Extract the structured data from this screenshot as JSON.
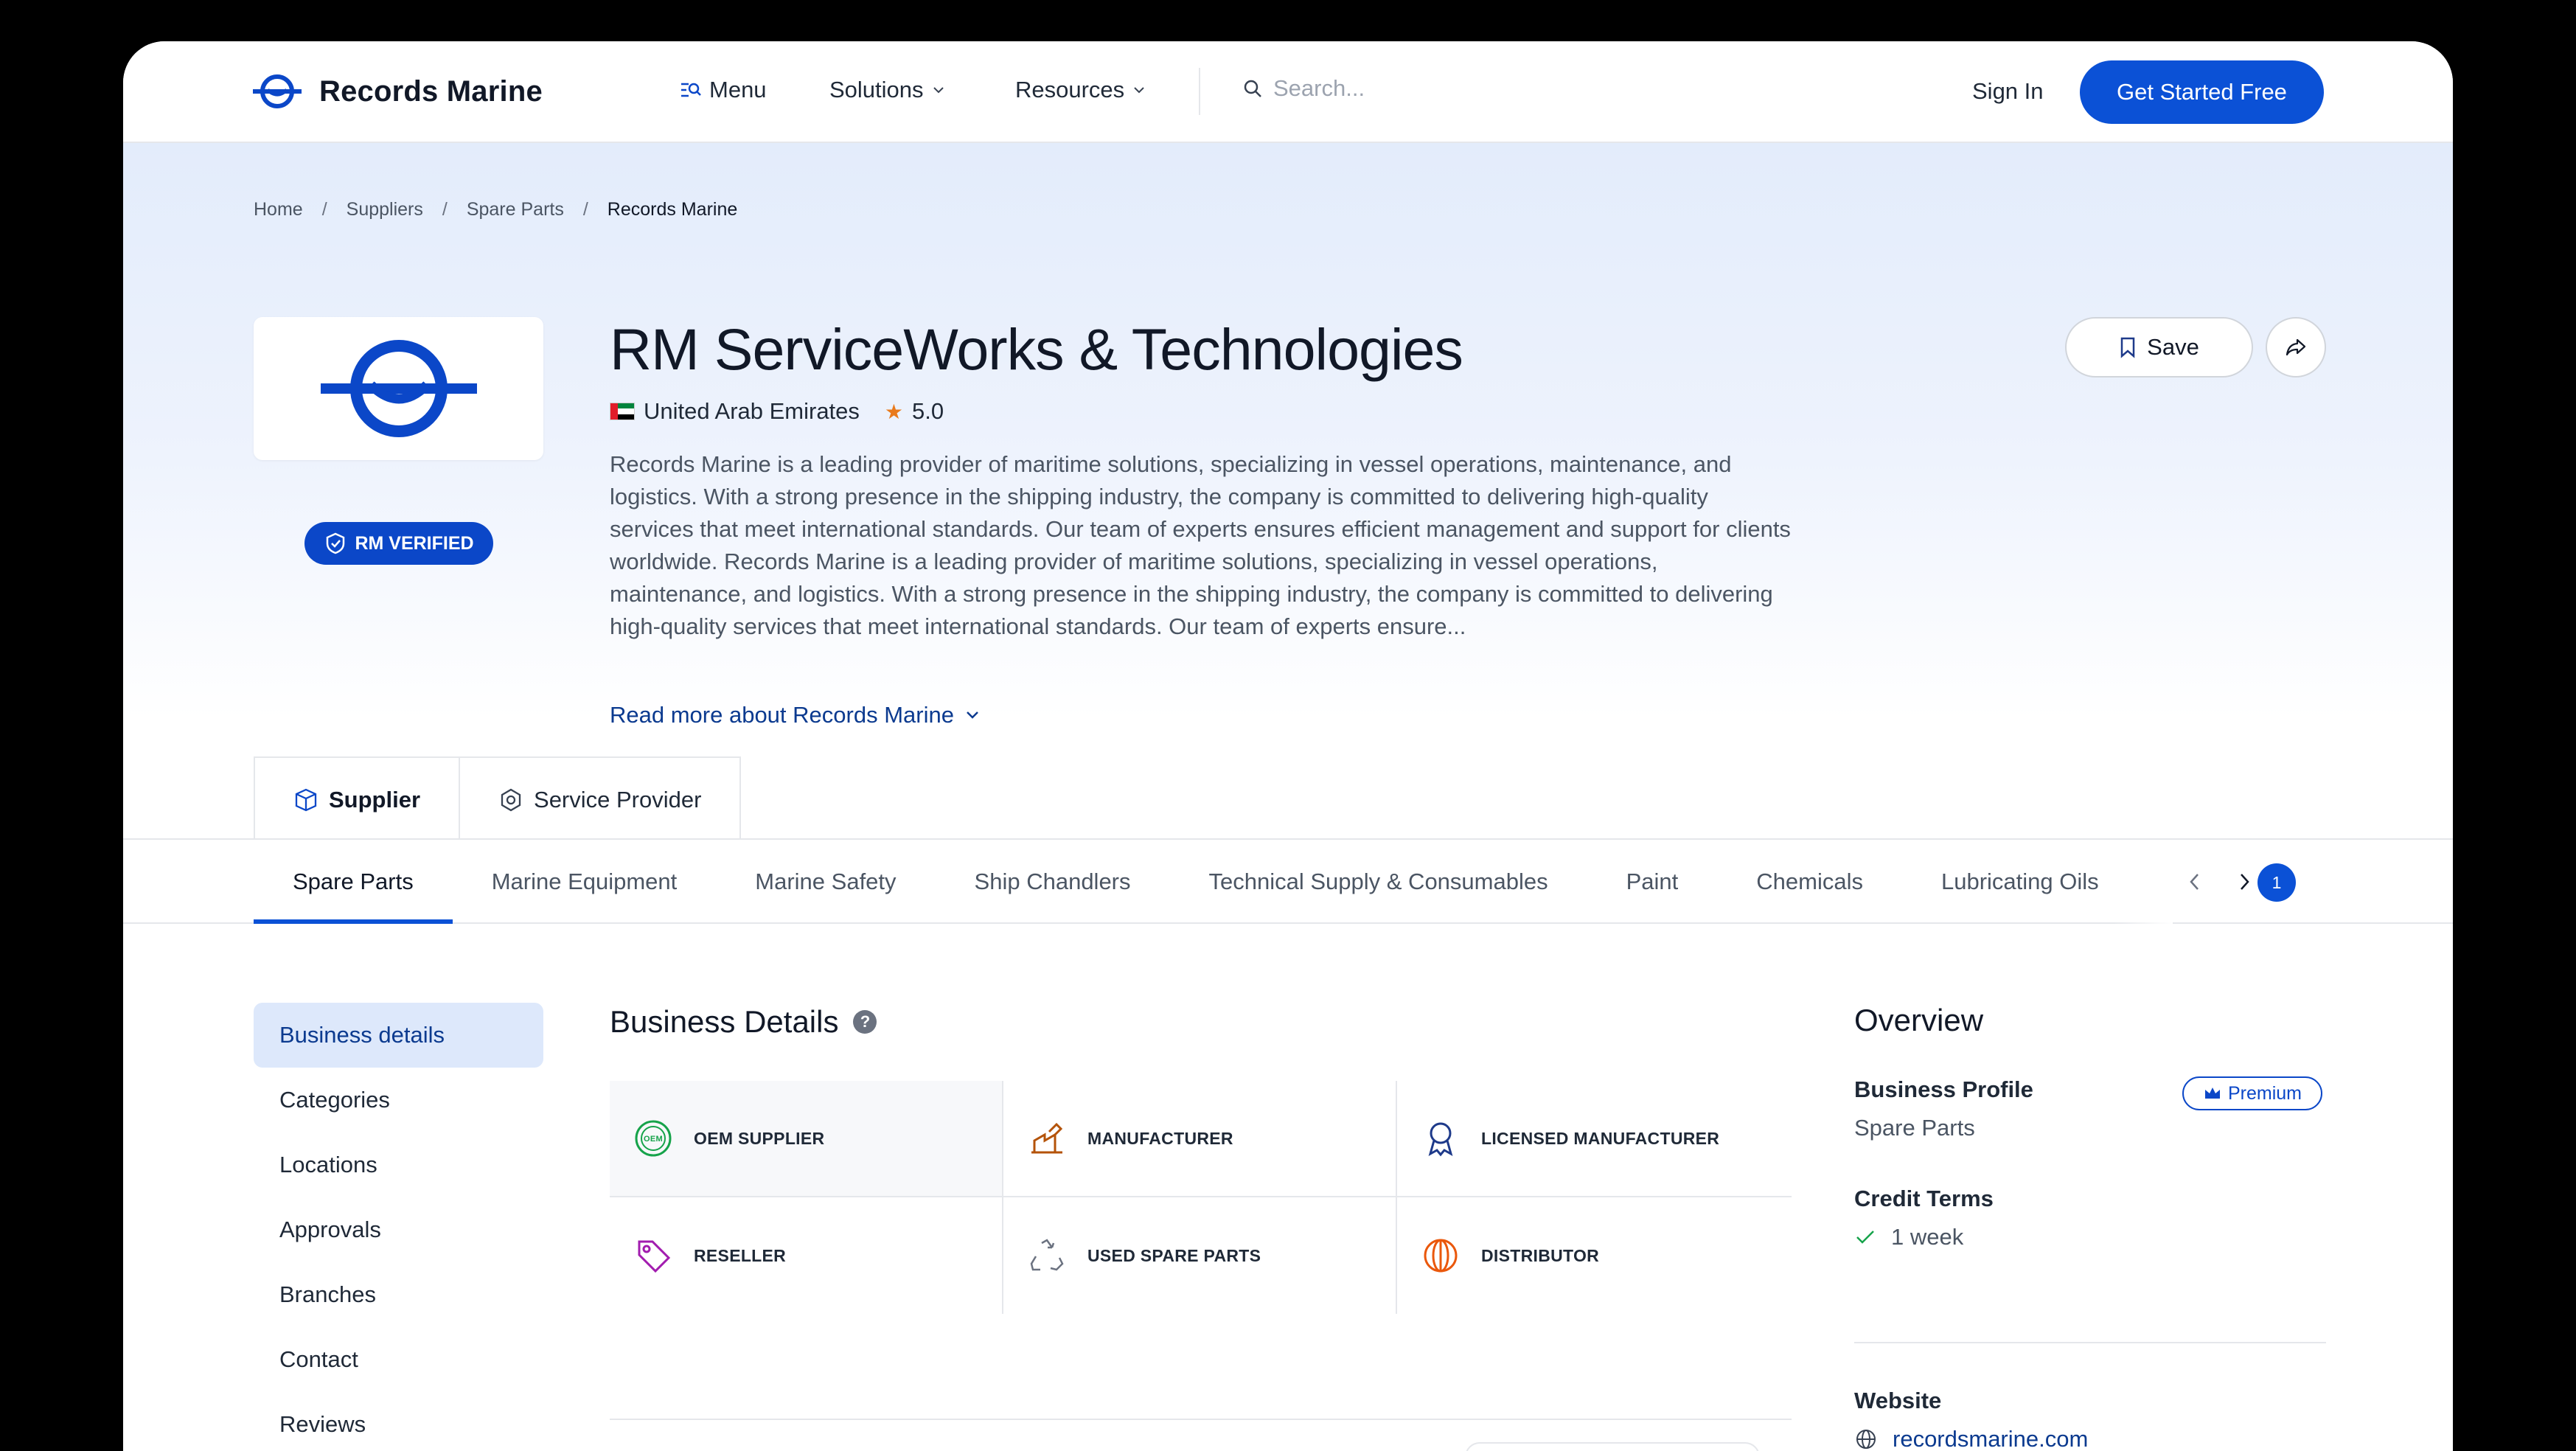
{
  "nav": {
    "logo_text": "Records Marine",
    "menu_label": "Menu",
    "solutions_label": "Solutions",
    "resources_label": "Resources",
    "search_placeholder": "Search...",
    "signin_label": "Sign In",
    "cta_label": "Get Started Free"
  },
  "breadcrumb": {
    "items": [
      "Home",
      "Suppliers",
      "Spare Parts",
      "Records Marine"
    ],
    "separator": "/"
  },
  "company": {
    "name": "RM ServiceWorks & Technologies",
    "country": "United Arab Emirates",
    "rating": "5.0",
    "verified_label": "RM VERIFIED",
    "description": "Records Marine is a leading provider of maritime solutions, specializing in vessel operations, maintenance, and logistics. With a strong presence in the shipping industry, the company is committed to delivering high-quality services that meet international standards. Our team of experts ensures efficient management and support for clients worldwide. Records Marine is a leading provider of maritime solutions, specializing in vessel operations, maintenance, and logistics. With a strong presence in the shipping industry, the company is committed to delivering high-quality services that meet international standards. Our team of experts ensure...",
    "read_more_label": "Read more about Records Marine",
    "save_label": "Save"
  },
  "role_tabs": [
    "Supplier",
    "Service Provider"
  ],
  "categories": {
    "items": [
      "Spare Parts",
      "Marine Equipment",
      "Marine Safety",
      "Ship Chandlers",
      "Technical Supply & Consumables",
      "Paint",
      "Chemicals",
      "Lubricating Oils"
    ],
    "badge": "1"
  },
  "sidebar": {
    "items": [
      "Business details",
      "Categories",
      "Locations",
      "Approvals",
      "Branches",
      "Contact",
      "Reviews"
    ]
  },
  "business_details": {
    "title": "Business Details",
    "help_icon": "?",
    "types": [
      {
        "label": "OEM SUPPLIER",
        "icon": "oem-badge-icon",
        "color": "#16a34a"
      },
      {
        "label": "MANUFACTURER",
        "icon": "factory-icon",
        "color": "#b45309"
      },
      {
        "label": "LICENSED MANUFACTURER",
        "icon": "award-icon",
        "color": "#1e3a8a"
      },
      {
        "label": "RESELLER",
        "icon": "tag-icon",
        "color": "#a21caf"
      },
      {
        "label": "USED SPARE PARTS",
        "icon": "recycle-icon",
        "color": "#6b7280"
      },
      {
        "label": "DISTRIBUTOR",
        "icon": "globe-icon",
        "color": "#ea580c"
      }
    ]
  },
  "overview": {
    "title": "Overview",
    "business_profile_label": "Business Profile",
    "premium_label": "Premium",
    "business_profile_value": "Spare Parts",
    "credit_terms_label": "Credit Terms",
    "credit_terms_value": "1 week",
    "website_label": "Website",
    "website_value": "recordsmarine.com"
  },
  "colors": {
    "brand": "#0b51d6",
    "brand_dark": "#0b47c8",
    "link": "#0b3a8f"
  }
}
